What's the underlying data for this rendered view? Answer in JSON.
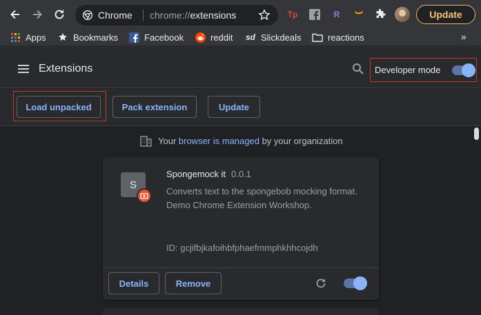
{
  "browser": {
    "site_label": "Chrome",
    "url_scheme": "chrome://",
    "url_host": "extensions",
    "update_label": "Update",
    "extension_icons": [
      {
        "name": "tampermonkey-icon",
        "glyph": "Tp",
        "color": "#e8453c"
      },
      {
        "name": "facebook-container-icon",
        "glyph": "f",
        "color": "#9aa0a6"
      },
      {
        "name": "r-extension-icon",
        "glyph": "R",
        "color": "#a274d6"
      },
      {
        "name": "amazon-icon",
        "glyph": "⌣",
        "color": "#ff9900"
      },
      {
        "name": "puzzle-icon",
        "glyph": "",
        "color": "#e8eaed"
      }
    ]
  },
  "bookmarks": [
    {
      "label": "Apps",
      "icon": "apps-grid-icon"
    },
    {
      "label": "Bookmarks",
      "icon": "star-icon"
    },
    {
      "label": "Facebook",
      "icon": "facebook-icon"
    },
    {
      "label": "reddit",
      "icon": "reddit-icon"
    },
    {
      "label": "Slickdeals",
      "icon": "slickdeals-icon"
    },
    {
      "label": "reactions",
      "icon": "folder-icon"
    }
  ],
  "header": {
    "title": "Extensions",
    "developer_mode_label": "Developer mode",
    "developer_mode_on": true
  },
  "toolbar": {
    "load_unpacked": "Load unpacked",
    "pack_extension": "Pack extension",
    "update": "Update"
  },
  "managed_notice": {
    "prefix": "Your ",
    "link": "browser is managed",
    "suffix": " by your organization"
  },
  "extension_card": {
    "icon_letter": "S",
    "name": "Spongemock it",
    "version": "0.0.1",
    "description": "Converts text to the spongebob mocking format. Demo Chrome Extension Workshop.",
    "id_text": "ID: gcjifbjkafoihbfphaefmmphkhhcojdh",
    "details_label": "Details",
    "remove_label": "Remove",
    "enabled": true
  },
  "colors": {
    "accent": "#8ab4f8",
    "highlight_border": "#c0392b",
    "update_orange": "#f8c472"
  }
}
